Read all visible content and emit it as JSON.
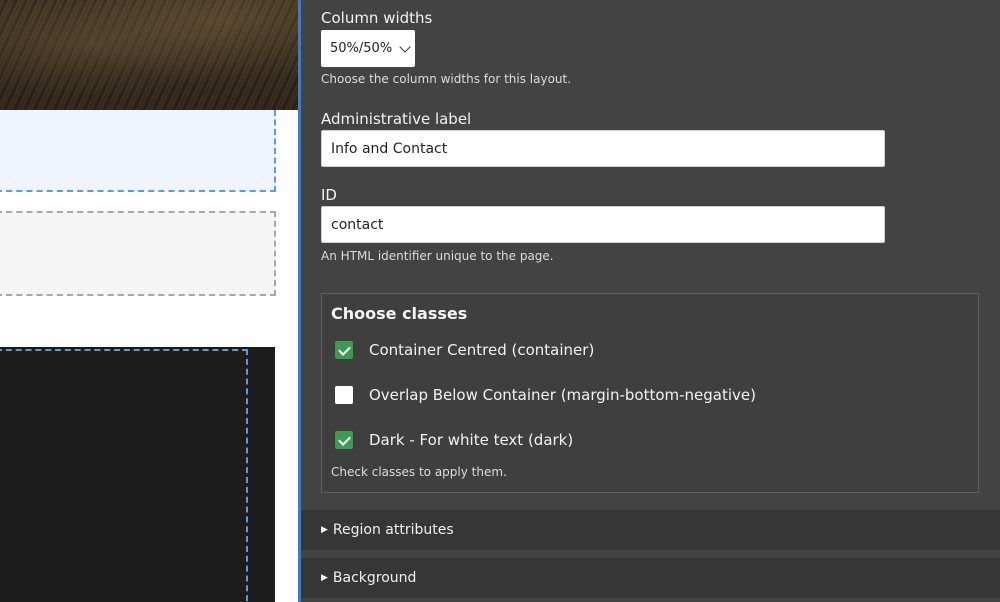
{
  "settings": {
    "column_widths_label": "Column widths",
    "column_widths_value": "50%/50%",
    "column_widths_help": "Choose the column widths for this layout.",
    "admin_label": "Administrative label",
    "admin_value": "Info and Contact",
    "id_label": "ID",
    "id_value": "contact",
    "id_help": "An HTML identifier unique to the page.",
    "classes": {
      "title": "Choose classes",
      "options": [
        {
          "label": "Container Centred (container)",
          "checked": true
        },
        {
          "label": "Overlap Below Container (margin-bottom-negative)",
          "checked": false
        },
        {
          "label": "Dark - For white text (dark)",
          "checked": true
        }
      ],
      "help": "Check classes to apply them."
    },
    "region_attributes": "Region attributes",
    "background": "Background"
  },
  "colors": {
    "panel_bg": "#434343",
    "accent": "#3a7bd5",
    "checkbox_checked": "#3d9a52",
    "region_highlight": "#eef5fe"
  },
  "icons": [
    "chevron-down-icon",
    "checkbox-checked-icon",
    "checkbox-empty-icon",
    "triangle-right-icon"
  ]
}
